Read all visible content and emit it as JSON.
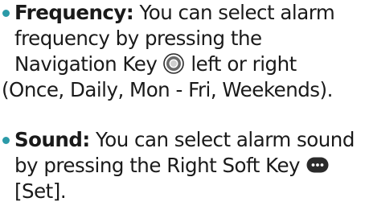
{
  "colors": {
    "bullet": "#2b9aa8",
    "text": "#1a1a1a",
    "icon_dark": "#2a2a2a"
  },
  "items": [
    {
      "term": "Frequency:",
      "lines": [
        " You can select alarm",
        "frequency by pressing the",
        "Navigation Key",
        "left or right",
        "(Once, Daily, Mon - Fri, Weekends)."
      ],
      "icon": "navigation-key-icon"
    },
    {
      "term": "Sound:",
      "lines": [
        " You can select alarm sound",
        "by pressing the Right Soft Key",
        "[Set]."
      ],
      "icon": "right-soft-key-icon"
    }
  ]
}
